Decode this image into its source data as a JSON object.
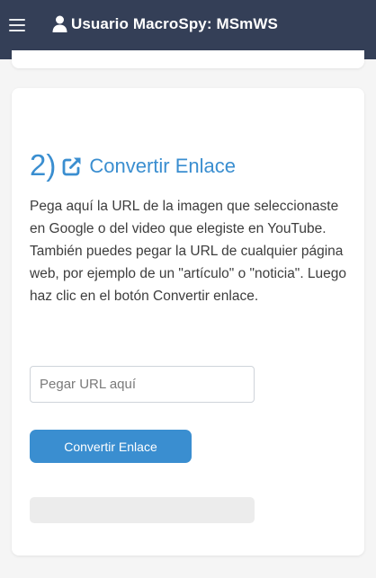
{
  "header": {
    "menu_icon": "hamburger-menu-icon",
    "user_icon": "user-icon",
    "user_label": "Usuario MacroSpy: MSmWS",
    "background_color": "#343f57"
  },
  "step": {
    "number": "2)",
    "icon": "external-link-icon",
    "title": "Convertir Enlace",
    "accent_color": "#3a8ed0",
    "description": "Pega aquí la URL de la imagen que seleccionaste en Google o del video que elegiste en YouTube. También puedes pegar la URL de cualquier página web, por ejemplo de un \"artículo\" o \"noticia\". Luego haz clic en el botón Convertir enlace.",
    "url_input": {
      "value": "",
      "placeholder": "Pegar URL aquí"
    },
    "convert_button_label": "Convertir Enlace",
    "result": ""
  }
}
